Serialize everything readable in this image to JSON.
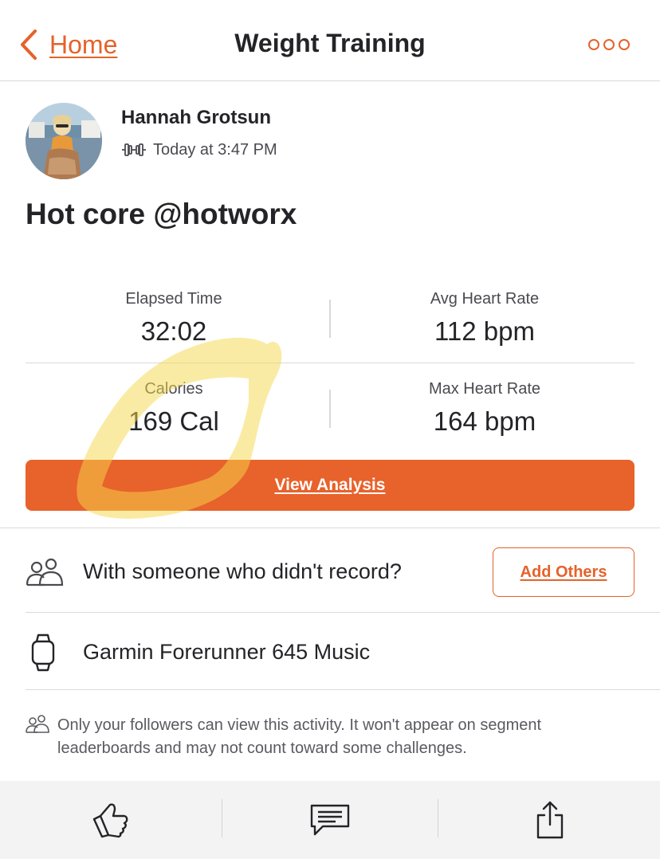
{
  "header": {
    "back_label": "Home",
    "title": "Weight Training",
    "more_icon": "more-horizontal-icon",
    "accent_color": "#e5622a"
  },
  "activity": {
    "athlete_name": "Hannah Grotsun",
    "activity_icon": "dumbbell-icon",
    "timestamp": "Today at 3:47 PM",
    "name": "Hot core @hotworx"
  },
  "stats": [
    {
      "label": "Elapsed Time",
      "value": "32:02"
    },
    {
      "label": "Avg Heart Rate",
      "value": "112 bpm"
    },
    {
      "label": "Calories",
      "value": "169 Cal"
    },
    {
      "label": "Max Heart Rate",
      "value": "164 bpm"
    }
  ],
  "view_analysis_label": "View Analysis",
  "group": {
    "icon": "people-icon",
    "text": "With someone who didn't record?",
    "button_label": "Add Others"
  },
  "device": {
    "icon": "watch-icon",
    "text": "Garmin Forerunner 645 Music"
  },
  "privacy": {
    "icon": "followers-icon",
    "text": "Only your followers can view this activity. It won't appear on segment leaderboards and may not count toward some challenges."
  },
  "bottom_bar": {
    "icons": [
      "kudos-thumbs-up-icon",
      "comment-icon",
      "share-icon"
    ]
  },
  "annotation": {
    "icon": "yellow-highlighter-scribble",
    "color": "#f5d84a"
  }
}
